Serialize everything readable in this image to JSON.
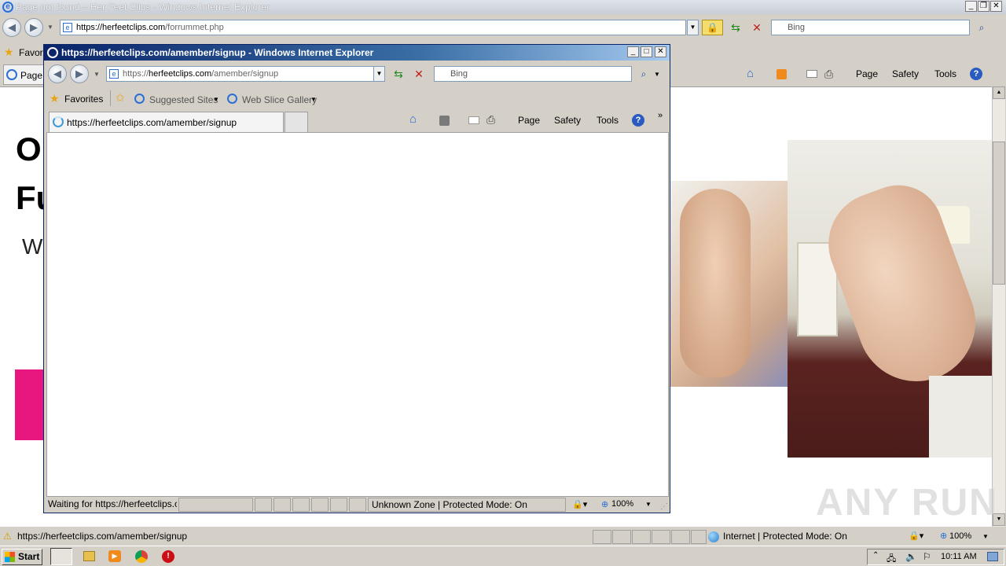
{
  "main_window": {
    "title": "Page not found – Her Feet Clips - Windows Internet Explorer",
    "address": {
      "scheme": "https://",
      "host": "herfeetclips.com",
      "path": "/forrummet.php"
    },
    "search_placeholder": "Bing",
    "favorites_label": "Favori",
    "tab_label": "Page",
    "commandbar": {
      "page": "Page",
      "safety": "Safety",
      "tools": "Tools"
    },
    "page_heading_1": "O",
    "page_heading_2": "Fu",
    "page_text": "W",
    "status_text": "https://herfeetclips.com/amember/signup",
    "zone": "Internet | Protected Mode: On",
    "zoom": "100%"
  },
  "popup_window": {
    "title": "https://herfeetclips.com/amember/signup - Windows Internet Explorer",
    "address": {
      "scheme": "https://",
      "host": "herfeetclips.com",
      "path": "/amember/signup"
    },
    "search_placeholder": "Bing",
    "favorites_label": "Favorites",
    "suggested_sites": "Suggested Sites",
    "web_slice_gallery": "Web Slice Gallery",
    "tab_label": "https://herfeetclips.com/amember/signup",
    "commandbar": {
      "page": "Page",
      "safety": "Safety",
      "tools": "Tools"
    },
    "status_text": "Waiting for https://herfeetclips.cc",
    "zone": "Unknown Zone | Protected Mode: On",
    "zoom": "100%"
  },
  "taskbar": {
    "start": "Start",
    "clock": "10:11 AM"
  },
  "watermark": "ANY RUN",
  "colors": {
    "pink_block": "#e8177f",
    "popup_title_start": "#0a246a",
    "popup_title_end": "#a6caf0"
  }
}
